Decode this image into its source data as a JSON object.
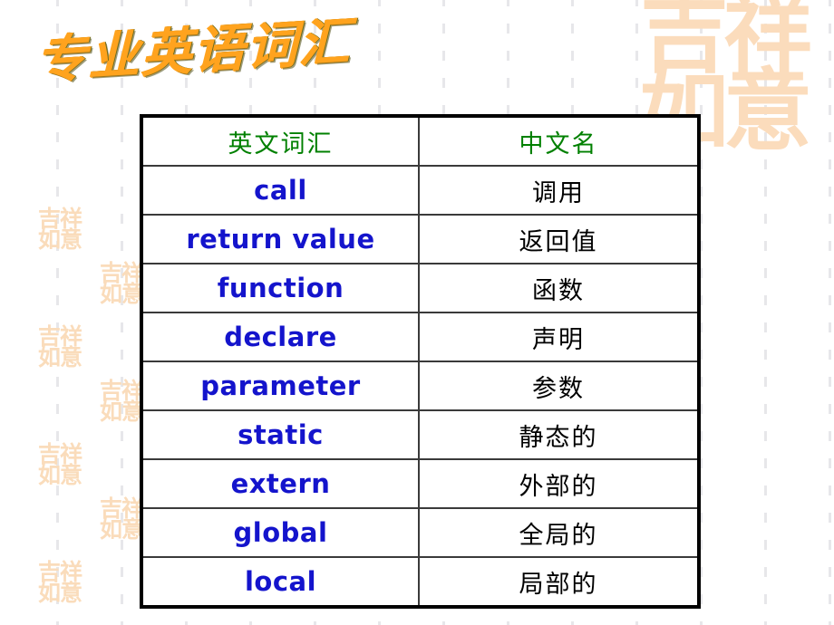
{
  "slide": {
    "title": "专业英语词汇",
    "background_color": "#ffffff",
    "title_color": "#FFA31E",
    "header_text_color": "#008000",
    "english_text_color": "#1414CC",
    "chinese_text_color": "#000000",
    "seal_color": "#fadcbb",
    "border_color": "#000000"
  },
  "decor": {
    "seal_text_small": "吉祥\n如意",
    "seal_text_large": "吉祥\n如意",
    "corner_seal_characters": "吉祥如意"
  },
  "table": {
    "headers": {
      "english": "英文词汇",
      "chinese": "中文名"
    },
    "rows": [
      {
        "english": "call",
        "chinese": "调用"
      },
      {
        "english": "return value",
        "chinese": "返回值"
      },
      {
        "english": "function",
        "chinese": "函数"
      },
      {
        "english": "declare",
        "chinese": "声明"
      },
      {
        "english": "parameter",
        "chinese": "参数"
      },
      {
        "english": "static",
        "chinese": "静态的"
      },
      {
        "english": "extern",
        "chinese": "外部的"
      },
      {
        "english": "global",
        "chinese": "全局的"
      },
      {
        "english": "local",
        "chinese": "局部的"
      }
    ]
  }
}
